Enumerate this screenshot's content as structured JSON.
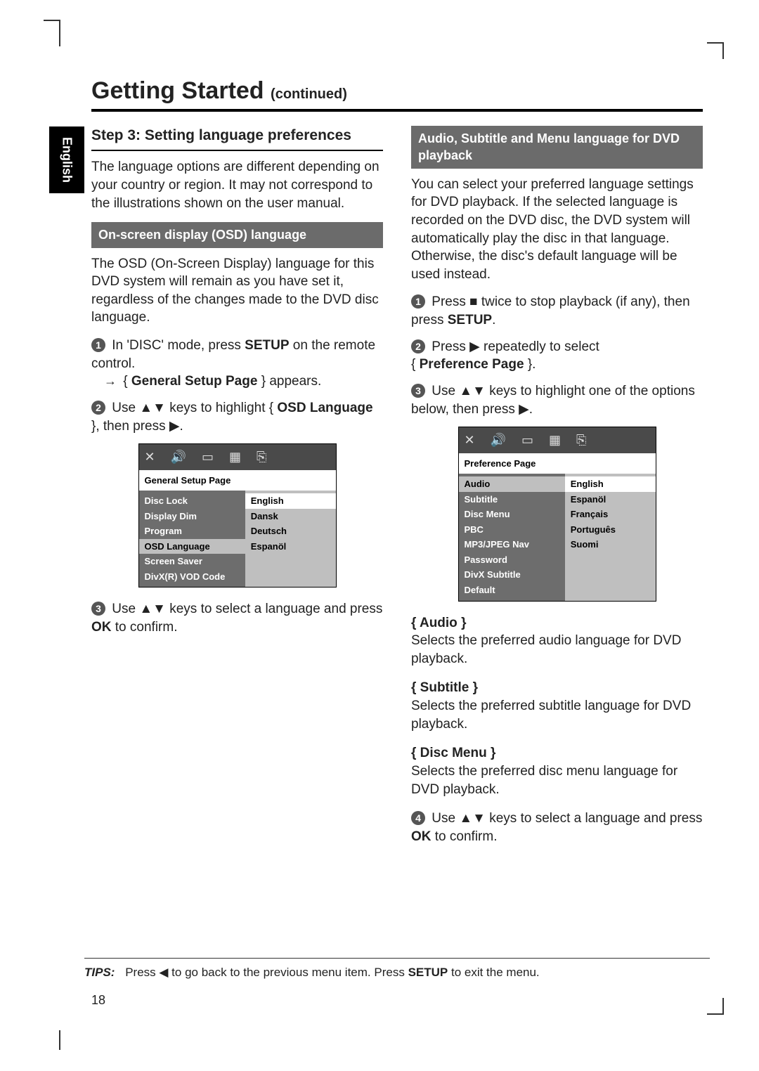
{
  "sideTab": "English",
  "title": "Getting Started",
  "titleCont": "(continued)",
  "stepHead": "Step 3:  Setting language preferences",
  "introPara": "The language options are different depending on your country or region.  It may not correspond to the illustrations shown on the user manual.",
  "osdHead": "On-screen display (OSD) language",
  "osdPara": "The OSD (On-Screen Display) language for this DVD system will remain as you have set it, regardless of the changes made to the DVD disc language.",
  "leftSteps": {
    "s1a": "In 'DISC' mode, press ",
    "s1b": "SETUP",
    "s1c": " on the remote control.",
    "s1arrow": "→",
    "s1d": "{ ",
    "s1e": "General Setup Page",
    "s1f": " } appears.",
    "s2a": "Use ▲▼ keys to highlight { ",
    "s2b": "OSD Language",
    "s2c": " }, then press ▶.",
    "s3a": "Use ▲▼ keys to select a language and press ",
    "s3b": "OK",
    "s3c": " to confirm."
  },
  "osdBox1": {
    "pageTitle": "General Setup Page",
    "left": [
      "Disc Lock",
      "Display Dim",
      "Program",
      "OSD Language",
      "Screen Saver",
      "DivX(R) VOD Code"
    ],
    "selectedLeft": "OSD Language",
    "right": [
      "English",
      "Dansk",
      "Deutsch",
      "Espanöl"
    ],
    "selectedRight": "English"
  },
  "avHead": "Audio, Subtitle and Menu language for DVD playback",
  "avPara": "You can select your preferred language settings for DVD playback.  If the selected language is recorded on the DVD disc, the DVD system will automatically play the disc in that language.  Otherwise, the disc's default language will be used instead.",
  "rightSteps": {
    "s1a": "Press  ■  twice to stop playback (if any), then press ",
    "s1b": "SETUP",
    "s1c": ".",
    "s2a": "Press ▶ repeatedly to select",
    "s2b": "{ ",
    "s2c": "Preference Page",
    "s2d": " }.",
    "s3a": "Use ▲▼ keys to highlight one of the options below, then press ▶.",
    "s4a": "Use ▲▼ keys to select a language and press ",
    "s4b": "OK",
    "s4c": " to confirm."
  },
  "osdBox2": {
    "pageTitle": "Preference Page",
    "left": [
      "Audio",
      "Subtitle",
      "Disc Menu",
      "PBC",
      "MP3/JPEG Nav",
      "Password",
      "DivX Subtitle",
      "Default"
    ],
    "selectedLeft": "Audio",
    "right": [
      "English",
      "Espanöl",
      "Français",
      "Português",
      "Suomi"
    ],
    "selectedRight": "English"
  },
  "defs": {
    "audioH": "{ Audio }",
    "audioT": "Selects the preferred audio language for DVD playback.",
    "subH": "{ Subtitle }",
    "subT": "Selects the preferred subtitle language for DVD playback.",
    "menuH": "{ Disc Menu }",
    "menuT": "Selects the preferred disc menu language for DVD playback."
  },
  "tips": {
    "label": "TIPS:",
    "t1": "Press ◀ to go back to the previous menu item.  Press ",
    "t2": "SETUP",
    "t3": " to exit the menu."
  },
  "pageNumber": "18"
}
